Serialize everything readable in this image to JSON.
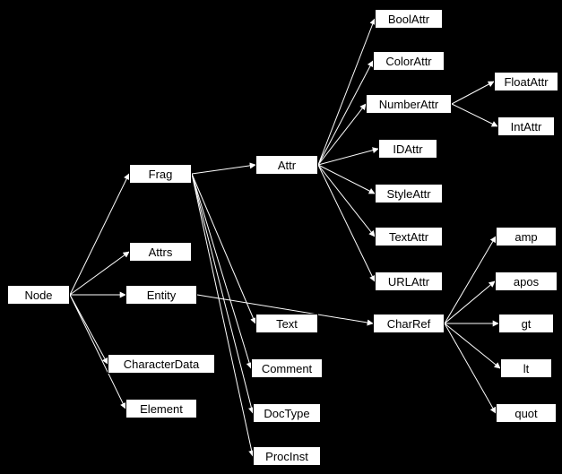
{
  "nodes": {
    "node": "Node",
    "frag": "Frag",
    "attrs": "Attrs",
    "entity": "Entity",
    "characterData": "CharacterData",
    "element": "Element",
    "attr": "Attr",
    "text": "Text",
    "comment": "Comment",
    "docType": "DocType",
    "procInst": "ProcInst",
    "boolAttr": "BoolAttr",
    "colorAttr": "ColorAttr",
    "numberAttr": "NumberAttr",
    "idAttr": "IDAttr",
    "styleAttr": "StyleAttr",
    "textAttr": "TextAttr",
    "urlAttr": "URLAttr",
    "charRef": "CharRef",
    "floatAttr": "FloatAttr",
    "intAttr": "IntAttr",
    "amp": "amp",
    "apos": "apos",
    "gt": "gt",
    "lt": "lt",
    "quot": "quot"
  },
  "edges": [
    [
      "node",
      "frag"
    ],
    [
      "node",
      "attrs"
    ],
    [
      "node",
      "entity"
    ],
    [
      "node",
      "characterData"
    ],
    [
      "node",
      "element"
    ],
    [
      "frag",
      "attr"
    ],
    [
      "frag",
      "text"
    ],
    [
      "frag",
      "comment"
    ],
    [
      "frag",
      "docType"
    ],
    [
      "frag",
      "procInst"
    ],
    [
      "attr",
      "boolAttr"
    ],
    [
      "attr",
      "colorAttr"
    ],
    [
      "attr",
      "numberAttr"
    ],
    [
      "attr",
      "idAttr"
    ],
    [
      "attr",
      "styleAttr"
    ],
    [
      "attr",
      "textAttr"
    ],
    [
      "attr",
      "urlAttr"
    ],
    [
      "entity",
      "charRef"
    ],
    [
      "numberAttr",
      "floatAttr"
    ],
    [
      "numberAttr",
      "intAttr"
    ],
    [
      "charRef",
      "amp"
    ],
    [
      "charRef",
      "apos"
    ],
    [
      "charRef",
      "gt"
    ],
    [
      "charRef",
      "lt"
    ],
    [
      "charRef",
      "quot"
    ]
  ],
  "positions": {
    "node": [
      8,
      318,
      70,
      22
    ],
    "frag": [
      144,
      183,
      70,
      22
    ],
    "attrs": [
      144,
      270,
      70,
      22
    ],
    "entity": [
      140,
      318,
      80,
      22
    ],
    "characterData": [
      120,
      395,
      120,
      22
    ],
    "element": [
      140,
      445,
      80,
      22
    ],
    "attr": [
      285,
      173,
      70,
      22
    ],
    "text": [
      285,
      350,
      70,
      22
    ],
    "comment": [
      280,
      400,
      80,
      22
    ],
    "docType": [
      282,
      450,
      76,
      22
    ],
    "procInst": [
      282,
      498,
      76,
      22
    ],
    "boolAttr": [
      418,
      10,
      76,
      22
    ],
    "colorAttr": [
      416,
      57,
      80,
      22
    ],
    "numberAttr": [
      408,
      105,
      96,
      22
    ],
    "idAttr": [
      422,
      155,
      66,
      22
    ],
    "styleAttr": [
      418,
      205,
      76,
      22
    ],
    "textAttr": [
      418,
      253,
      76,
      22
    ],
    "urlAttr": [
      418,
      303,
      76,
      22
    ],
    "charRef": [
      416,
      350,
      80,
      22
    ],
    "floatAttr": [
      551,
      80,
      72,
      22
    ],
    "intAttr": [
      555,
      130,
      64,
      22
    ],
    "amp": [
      553,
      253,
      68,
      22
    ],
    "apos": [
      552,
      303,
      70,
      22
    ],
    "gt": [
      556,
      350,
      62,
      22
    ],
    "lt": [
      558,
      400,
      58,
      22
    ],
    "quot": [
      553,
      450,
      68,
      22
    ]
  }
}
